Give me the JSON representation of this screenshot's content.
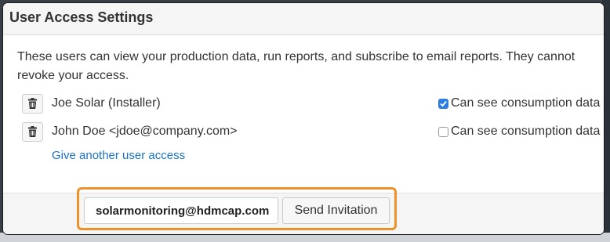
{
  "panel": {
    "title": "User Access Settings",
    "description": "These users can view your production data, run reports, and subscribe to email reports. They cannot revoke your access."
  },
  "users": [
    {
      "name": "Joe Solar (Installer)",
      "permission_label": "Can see consumption data",
      "permission_checked": true,
      "delete_icon": "trash-icon"
    },
    {
      "name": "John Doe <jdoe@company.com>",
      "permission_label": "Can see consumption data",
      "permission_checked": false,
      "delete_icon": "trash-icon"
    }
  ],
  "add_user_link": "Give another user access",
  "invite": {
    "email_value": "solarmonitoring@hdmcap.com",
    "send_label": "Send Invitation"
  },
  "colors": {
    "accent_link": "#1a73c8",
    "checkbox_checked": "#2d7de0",
    "highlight": "#f0902a"
  }
}
